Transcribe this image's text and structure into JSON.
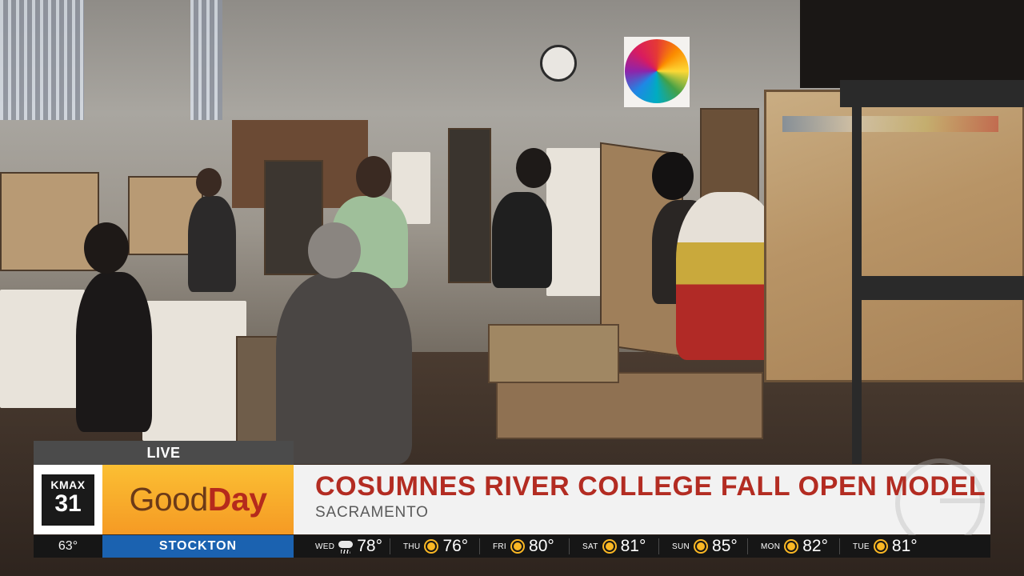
{
  "live_label": "LIVE",
  "station_logo": {
    "call_letters": "KMAX",
    "channel": "31"
  },
  "show_name": {
    "part1": "Good",
    "part2": "Day"
  },
  "headline": "COSUMNES RIVER COLLEGE FALL OPEN MODEL",
  "location": "SACRAMENTO",
  "current_temp": "63°",
  "forecast_city": "STOCKTON",
  "forecast": [
    {
      "day": "WED",
      "icon": "rain-cloud-icon",
      "temp": "78°"
    },
    {
      "day": "THU",
      "icon": "sun-icon",
      "temp": "76°"
    },
    {
      "day": "FRI",
      "icon": "sun-icon",
      "temp": "80°"
    },
    {
      "day": "SAT",
      "icon": "sun-icon",
      "temp": "81°"
    },
    {
      "day": "SUN",
      "icon": "sun-icon",
      "temp": "85°"
    },
    {
      "day": "MON",
      "icon": "sun-icon",
      "temp": "82°"
    },
    {
      "day": "TUE",
      "icon": "sun-icon",
      "temp": "81°"
    }
  ],
  "colors": {
    "headline_red": "#b32c22",
    "show_orange": "#f59a24",
    "city_blue": "#1b62b0",
    "ticker_bg": "#161616",
    "sun_yellow": "#fbb824"
  }
}
